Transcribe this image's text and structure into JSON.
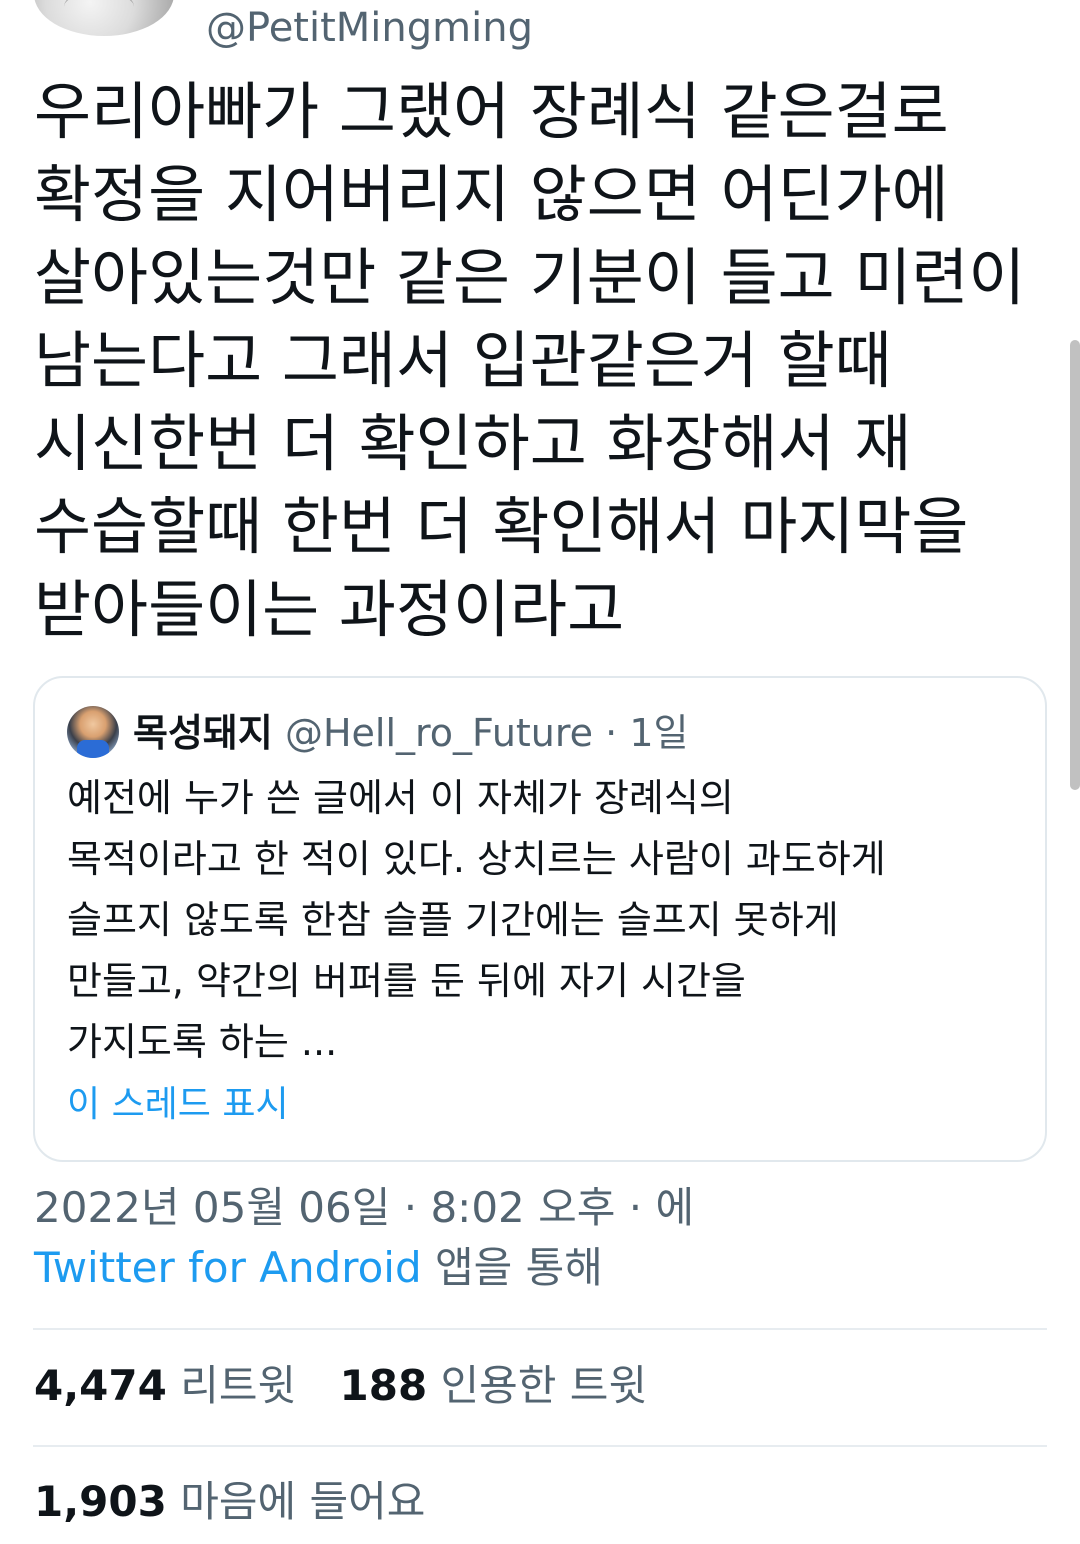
{
  "author": {
    "handle": "@PetitMingming"
  },
  "tweet": {
    "lines": [
      "우리아빠가 그랬어 장례식 같은걸로",
      "확정을 지어버리지 않으면 어딘가에",
      "살아있는것만 같은 기분이 들고 미련이",
      "남는다고 그래서 입관같은거 할때",
      "시신한번 더 확인하고 화장해서 재",
      "수습할때 한번 더 확인해서 마지막을",
      "받아들이는 과정이라고"
    ]
  },
  "quote": {
    "name": "목성돼지",
    "handle": "@Hell_ro_Future",
    "separator": "·",
    "time": "1일",
    "lines": [
      "예전에 누가 쓴 글에서 이 자체가 장례식의",
      "목적이라고 한 적이 있다. 상치르는 사람이 과도하게",
      "슬프지 않도록 한참 슬플 기간에는 슬프지 못하게",
      "만들고, 약간의 버퍼를 둔 뒤에 자기 시간을",
      "가지도록 하는 ..."
    ],
    "show_thread": "이 스레드 표시"
  },
  "meta": {
    "timestamp": "2022년 05월 06일 · 8:02 오후 · 에",
    "source": "Twitter for Android",
    "source_suffix": " 앱을 통해"
  },
  "stats": {
    "retweets_count": "4,474",
    "retweets_label": "리트윗",
    "quotes_count": "188",
    "quotes_label": "인용한 트윗",
    "likes_count": "1,903",
    "likes_label": "마음에 들어요"
  },
  "colors": {
    "link": "#1d9bf0",
    "secondary_text": "#536471",
    "primary_text": "#0f1419",
    "border": "#e1e8ed"
  }
}
